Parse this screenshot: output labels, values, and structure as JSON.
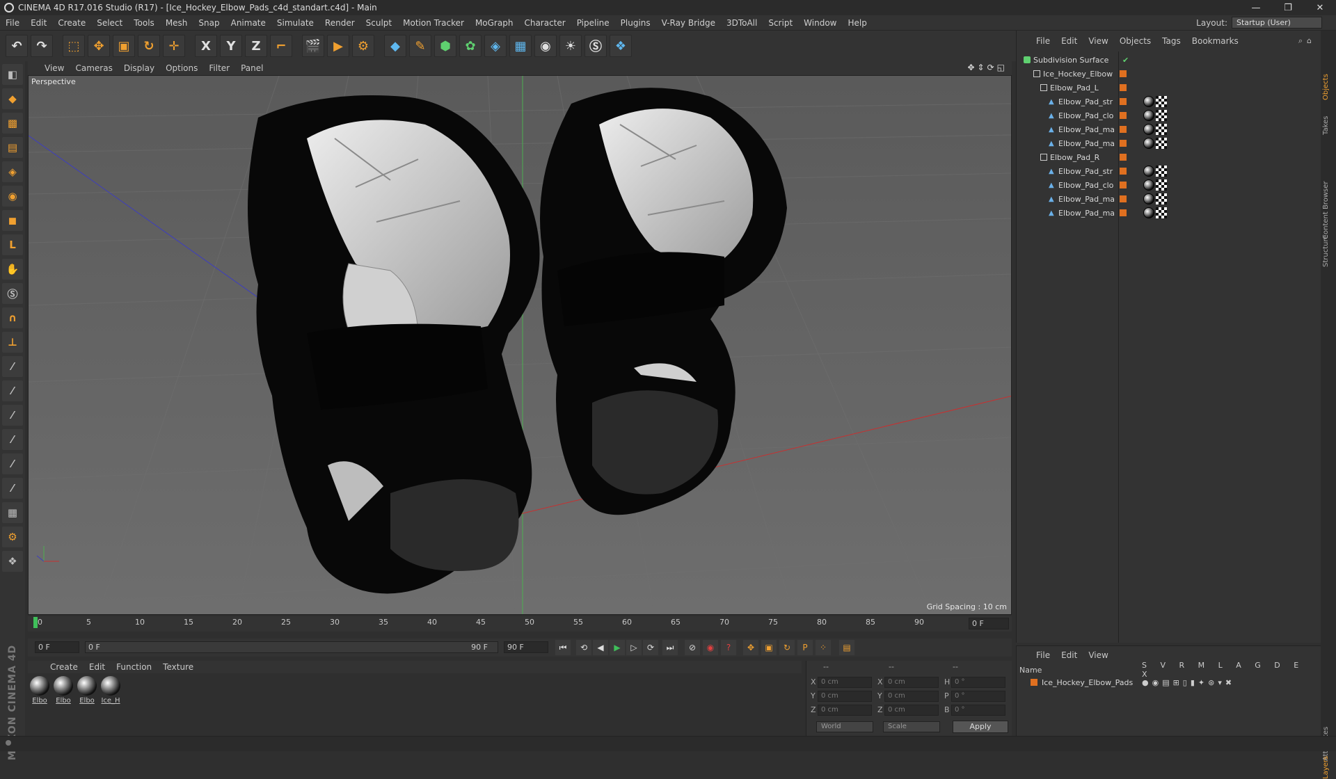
{
  "window": {
    "title": "CINEMA 4D R17.016 Studio (R17) - [Ice_Hockey_Elbow_Pads_c4d_standart.c4d] - Main",
    "controls": [
      "—",
      "❐",
      "✕"
    ]
  },
  "menubar": {
    "items": [
      "File",
      "Edit",
      "Create",
      "Select",
      "Tools",
      "Mesh",
      "Snap",
      "Animate",
      "Simulate",
      "Render",
      "Sculpt",
      "Motion Tracker",
      "MoGraph",
      "Character",
      "Pipeline",
      "Plugins",
      "V-Ray Bridge",
      "3DToAll",
      "Script",
      "Window",
      "Help"
    ],
    "layout_label": "Layout:",
    "layout_value": "Startup (User)"
  },
  "toolbar": {
    "icons": [
      "undo-icon",
      "redo-icon",
      "live-selection-icon",
      "move-icon",
      "scale-icon",
      "rotate-icon",
      "transform-icon",
      "x-axis-icon",
      "y-axis-icon",
      "z-axis-icon",
      "coordinate-system-icon",
      "render-view-icon",
      "render-picture-viewer-icon",
      "render-settings-icon",
      "cube-icon",
      "pen-icon",
      "subdivision-icon",
      "array-icon",
      "deformer-icon",
      "floor-icon",
      "camera-icon",
      "light-icon",
      "vray-icon",
      "python-icon"
    ],
    "axis_labels": [
      "X",
      "Y",
      "Z"
    ]
  },
  "left_tools": [
    "model-mode-icon",
    "texture-mode-icon",
    "workplane-icon",
    "points-mode-icon",
    "edges-mode-icon",
    "polygons-mode-icon",
    "uv-icon",
    "brush-icon",
    "snap-icon",
    "magnet-icon",
    "axis-icon",
    "sculpt-icon-1",
    "sculpt-icon-2",
    "sculpt-icon-3",
    "sculpt-icon-4",
    "sculpt-icon-5",
    "sculpt-icon-6",
    "sculpt-icon-7",
    "grid-lock-icon",
    "gear-icon",
    "python-icon"
  ],
  "brand": "MAXON CINEMA 4D",
  "viewport": {
    "menu": [
      "View",
      "Cameras",
      "Display",
      "Options",
      "Filter",
      "Panel"
    ],
    "label": "Perspective",
    "grid_spacing": "Grid Spacing : 10 cm"
  },
  "timeline": {
    "ticks": [
      "0",
      "5",
      "10",
      "15",
      "20",
      "25",
      "30",
      "35",
      "40",
      "45",
      "50",
      "55",
      "60",
      "65",
      "70",
      "75",
      "80",
      "85",
      "90"
    ],
    "current_frame": "0 F"
  },
  "transport": {
    "start_field": "0 F",
    "range_start": "0 F",
    "range_end": "90 F",
    "end_field": "90 F"
  },
  "materials": {
    "menu": [
      "Create",
      "Edit",
      "Function",
      "Texture"
    ],
    "items": [
      "Elbo",
      "Elbo",
      "Elbo",
      "Ice_H"
    ]
  },
  "coordinates": {
    "header": [
      "--",
      "--",
      "--"
    ],
    "rows": [
      {
        "axis": "X",
        "pos": "0 cm",
        "axis2": "X",
        "size": "0 cm",
        "rot_label": "H",
        "rot": "0 °"
      },
      {
        "axis": "Y",
        "pos": "0 cm",
        "axis2": "Y",
        "size": "0 cm",
        "rot_label": "P",
        "rot": "0 °"
      },
      {
        "axis": "Z",
        "pos": "0 cm",
        "axis2": "Z",
        "size": "0 cm",
        "rot_label": "B",
        "rot": "0 °"
      }
    ],
    "world": "World",
    "scale": "Scale",
    "apply": "Apply"
  },
  "objects_panel": {
    "menu": [
      "File",
      "Edit",
      "View",
      "Objects",
      "Tags",
      "Bookmarks"
    ],
    "tree": [
      {
        "name": "Subdivision Surface",
        "depth": 0,
        "type": "subdivision",
        "tags": "check"
      },
      {
        "name": "Ice_Hockey_Elbow",
        "depth": 1,
        "type": "null",
        "tags": ""
      },
      {
        "name": "Elbow_Pad_L",
        "depth": 2,
        "type": "null",
        "tags": ""
      },
      {
        "name": "Elbow_Pad_str",
        "depth": 3,
        "type": "mesh",
        "tags": "mat"
      },
      {
        "name": "Elbow_Pad_clo",
        "depth": 3,
        "type": "mesh",
        "tags": "mat"
      },
      {
        "name": "Elbow_Pad_ma",
        "depth": 3,
        "type": "mesh",
        "tags": "mat"
      },
      {
        "name": "Elbow_Pad_ma",
        "depth": 3,
        "type": "mesh",
        "tags": "mat"
      },
      {
        "name": "Elbow_Pad_R",
        "depth": 2,
        "type": "null",
        "tags": ""
      },
      {
        "name": "Elbow_Pad_str",
        "depth": 3,
        "type": "mesh",
        "tags": "mat"
      },
      {
        "name": "Elbow_Pad_clo",
        "depth": 3,
        "type": "mesh",
        "tags": "mat"
      },
      {
        "name": "Elbow_Pad_ma",
        "depth": 3,
        "type": "mesh",
        "tags": "mat"
      },
      {
        "name": "Elbow_Pad_ma",
        "depth": 3,
        "type": "mesh",
        "tags": "mat"
      }
    ]
  },
  "layers_panel": {
    "menu": [
      "File",
      "Edit",
      "View"
    ],
    "name_header": "Name",
    "columns": "S V R M L A G D E X",
    "row_name": "Ice_Hockey_Elbow_Pads"
  },
  "side_tabs": [
    "Objects",
    "Takes",
    "Content Browser",
    "Structure",
    "Attributes",
    "Layers"
  ],
  "colors": {
    "accent_orange": "#e07020",
    "viewport_bg": "#5f5f5f",
    "panel_bg": "#333333"
  }
}
